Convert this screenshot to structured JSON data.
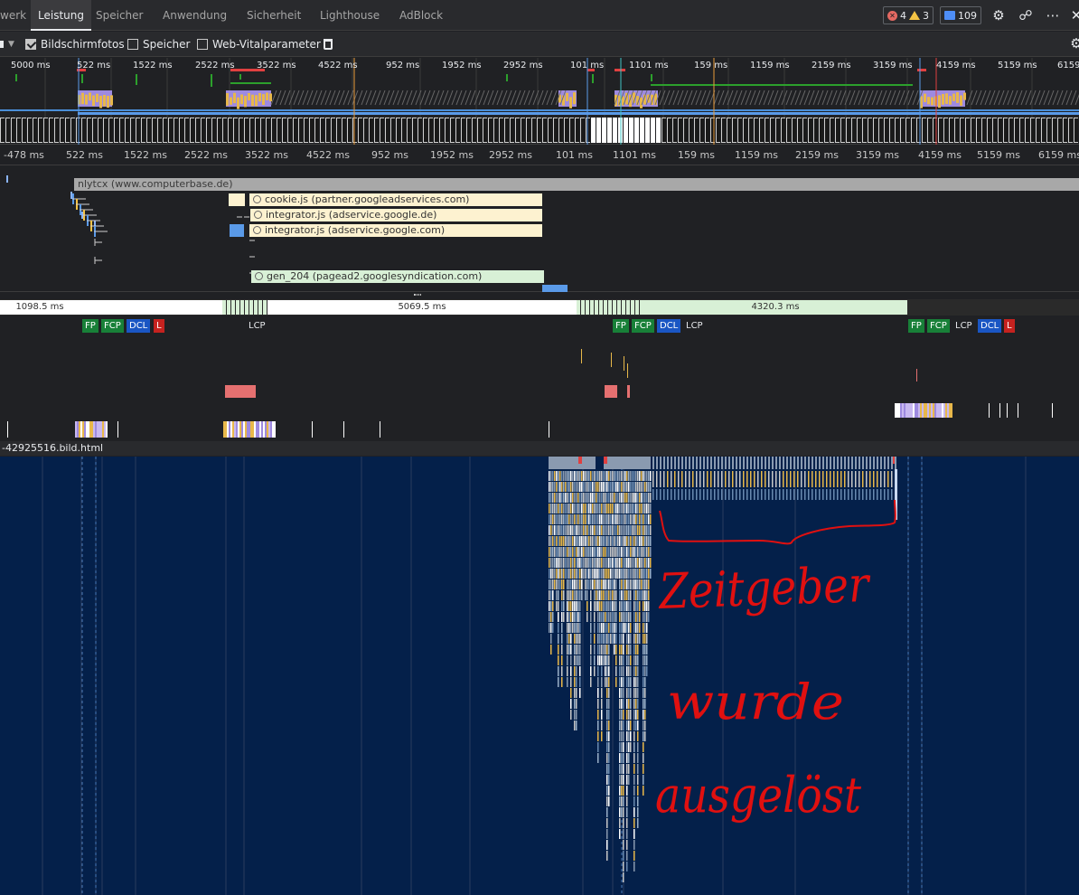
{
  "tabs": [
    {
      "label": "werk",
      "active": false
    },
    {
      "label": "Leistung",
      "active": true
    },
    {
      "label": "Speicher",
      "active": false
    },
    {
      "label": "Anwendung",
      "active": false
    },
    {
      "label": "Sicherheit",
      "active": false
    },
    {
      "label": "Lighthouse",
      "active": false
    },
    {
      "label": "AdBlock",
      "active": false
    }
  ],
  "status": {
    "errors": "4",
    "warnings": "3",
    "messages": "109"
  },
  "toolbar": {
    "screenshots_label": "Bildschirmfotos",
    "screenshots_checked": true,
    "memory_label": "Speicher",
    "memory_checked": false,
    "vitals_label": "Web-Vitalparameter",
    "vitals_checked": false
  },
  "overview_ruler": [
    "5000 ms",
    "522 ms",
    "1522 ms",
    "2522 ms",
    "3522 ms",
    "4522 ms",
    "952 ms",
    "1952 ms",
    "2952 ms",
    "101 ms",
    "1101 ms",
    "159 ms",
    "1159 ms",
    "2159 ms",
    "3159 ms",
    "4159 ms",
    "5159 ms",
    "6159"
  ],
  "main_ruler": [
    "-478 ms",
    "522 ms",
    "1522 ms",
    "2522 ms",
    "3522 ms",
    "4522 ms",
    "952 ms",
    "1952 ms",
    "2952 ms",
    "101 ms",
    "1101 ms",
    "159 ms",
    "1159 ms",
    "2159 ms",
    "3159 ms",
    "4159 ms",
    "5159 ms",
    "6159 ms"
  ],
  "network": {
    "page_request": "nlytcx (www.computerbase.de)",
    "requests": [
      "cookie.js (partner.googleadservices.com)",
      "integrator.js (adservice.google.de)",
      "integrator.js (adservice.google.com)",
      "gen_204 (pagead2.googlesyndication.com)"
    ]
  },
  "frames": [
    "1098.5 ms",
    "5069.5 ms",
    "4320.3 ms"
  ],
  "timings": {
    "fp": "FP",
    "fcp": "FCP",
    "dcl": "DCL",
    "l": "L",
    "lcp": "LCP"
  },
  "main_thread_url": "-42925516.bild.html",
  "annotation": {
    "line1": "Zeitgeber",
    "line2": "wurde",
    "line3": "ausgelöst"
  },
  "colors": {
    "flame_bg": "#04204a",
    "annotation_red": "#e01010",
    "fp_green": "#188038",
    "dcl_blue": "#1a56c4",
    "l_red": "#c5221f"
  }
}
